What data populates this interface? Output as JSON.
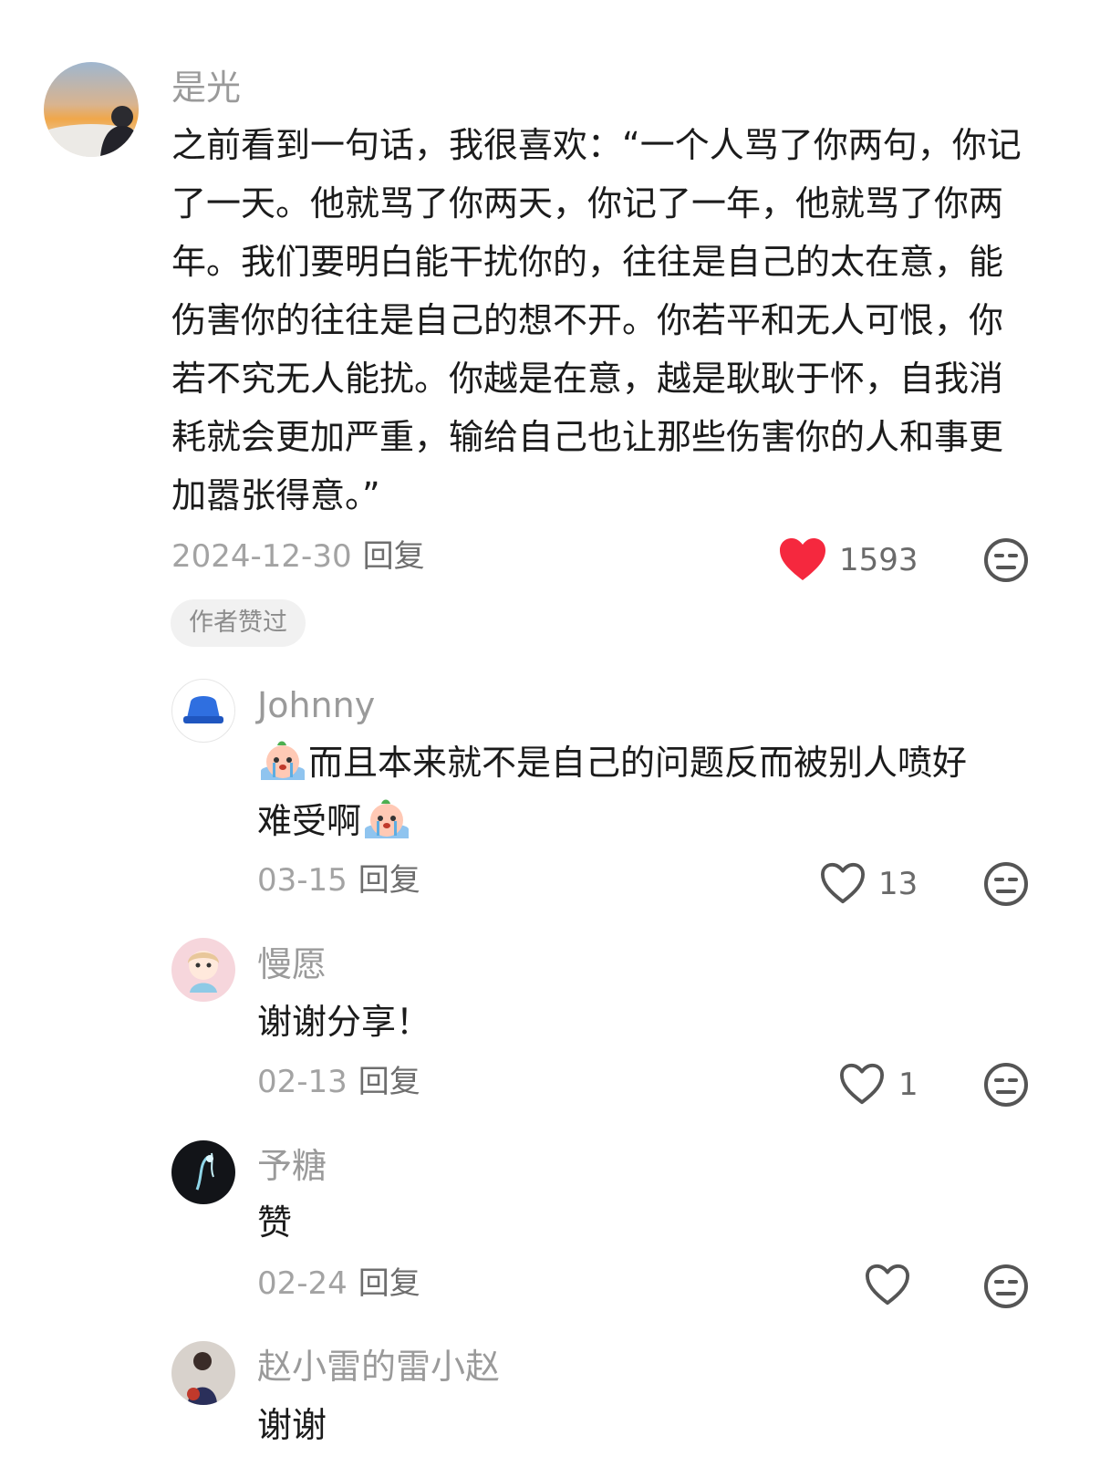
{
  "top_comment": {
    "username": "是光",
    "content": "之前看到一句话，我很喜欢：“一个人骂了你两句，你记了一天。他就骂了你两天，你记了一年，他就骂了你两年。我们要明白能干扰你的，往往是自己的太在意，能伤害你的往往是自己的想不开。你若平和无人可恨，你若不究无人能扰。你越是在意，越是耿耿于怀，自我消耗就会更加严重，输给自己也让那些伤害你的人和事更加嚣张得意。”",
    "date": "2024-12-30",
    "reply_label": "回复",
    "like_count": "1593",
    "liked": true,
    "badge": "作者赞过"
  },
  "replies": [
    {
      "username": "Johnny",
      "content_main": "而且本来就不是自己的问题反而被别人喷好",
      "content_tail": "难受啊",
      "date": "03-15",
      "reply_label": "回复",
      "like_count": "13",
      "emoji": "crying-peach-emoji"
    },
    {
      "username": "慢愿",
      "content": "谢谢分享！",
      "date": "02-13",
      "reply_label": "回复",
      "like_count": "1"
    },
    {
      "username": "予糖",
      "content": "赞",
      "date": "02-24",
      "reply_label": "回复",
      "like_count": ""
    },
    {
      "username": "赵小雷的雷小赵",
      "content": "谢谢"
    }
  ],
  "colors": {
    "like_active": "#f5283e",
    "icon_gray": "#555555",
    "username_gray": "#9a9a9a",
    "text": "#1b1b1b"
  }
}
